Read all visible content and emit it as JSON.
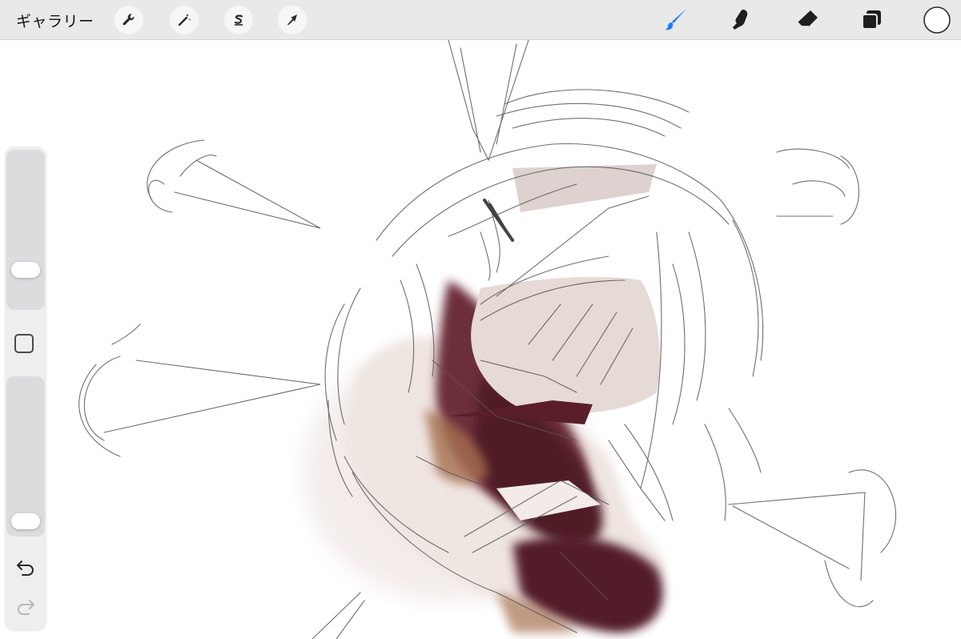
{
  "toolbar": {
    "gallery_label": "ギャラリー",
    "left_tools": [
      {
        "name": "actions",
        "icon": "wrench-icon"
      },
      {
        "name": "adjustments",
        "icon": "magic-wand-icon"
      },
      {
        "name": "selection",
        "icon": "selection-s-icon"
      },
      {
        "name": "transform",
        "icon": "arrow-cursor-icon"
      }
    ],
    "right_tools": [
      {
        "name": "brush",
        "icon": "brush-icon",
        "active": true
      },
      {
        "name": "smudge",
        "icon": "smudge-finger-icon"
      },
      {
        "name": "eraser",
        "icon": "eraser-icon"
      },
      {
        "name": "layers",
        "icon": "layers-icon"
      },
      {
        "name": "color",
        "icon": "color-swatch-icon",
        "value": "#ffffff"
      }
    ]
  },
  "sidebar": {
    "brush_size_level": 0.22,
    "opacity_level": 0.05,
    "undo_icon": "undo-arrow-icon",
    "redo_icon": "redo-arrow-icon"
  },
  "colors": {
    "active_tool": "#1a7bff",
    "toolbar_bg": "#e9e9ea",
    "paint_dark": "#5b1f2c",
    "paint_mid": "#a06a4f",
    "paint_light": "#e9dfdb"
  }
}
